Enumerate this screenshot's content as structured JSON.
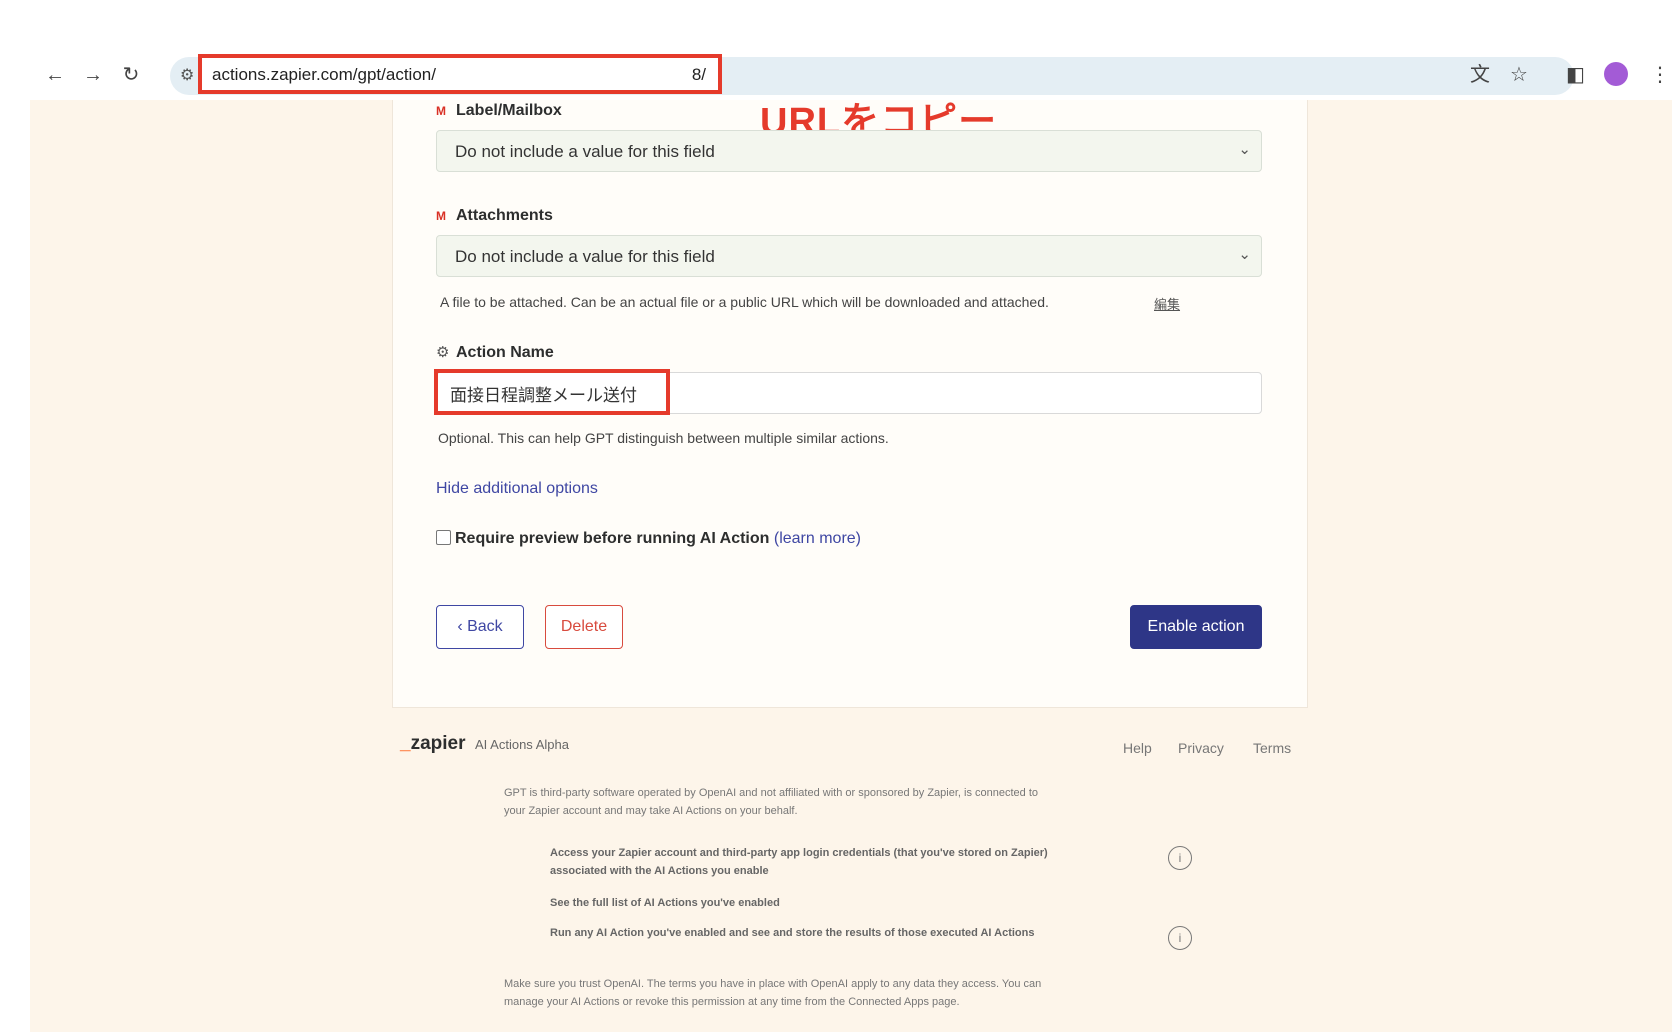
{
  "browser": {
    "url": "actions.zapier.com/gpt/action/",
    "url_tail": "8/"
  },
  "annotations": {
    "copy_url": "URLをコピー"
  },
  "form": {
    "label_mailbox": {
      "label": "Label/Mailbox",
      "value": "Do not include a value for this field"
    },
    "attachments": {
      "label": "Attachments",
      "value": "Do not include a value for this field",
      "help": "A file to be attached. Can be an actual file or a public URL which will be downloaded and attached.",
      "edit": "編集"
    },
    "action_name": {
      "label": "Action Name",
      "value": "面接日程調整メール送付",
      "help": "Optional. This can help GPT distinguish between multiple similar actions."
    },
    "hide_options": "Hide additional options",
    "require_preview": {
      "label": "Require preview before running AI Action",
      "learn_more": "(learn more)",
      "checked": false
    },
    "buttons": {
      "back": "‹ Back",
      "delete": "Delete",
      "enable": "Enable action"
    }
  },
  "footer": {
    "logo": "zapier",
    "tagline": "AI Actions Alpha",
    "links": [
      "Help",
      "Privacy",
      "Terms"
    ],
    "intro_1": "GPT is third-party software operated by OpenAI and not affiliated with or sponsored by Zapier, is connected to",
    "intro_2": "your Zapier account and may take AI Actions on your behalf.",
    "permissions": [
      "Access your Zapier account and third-party app login credentials (that you've stored on Zapier)",
      "associated with the AI Actions you enable",
      "See the full list of AI Actions you've enabled",
      "Run any AI Action you've enabled and see and store the results of those executed AI Actions"
    ],
    "trust_1": "Make sure you trust OpenAI. The terms you have in place with OpenAI apply to any data they access. You can",
    "trust_2": "manage your AI Actions or revoke this permission at any time from the Connected Apps page."
  }
}
